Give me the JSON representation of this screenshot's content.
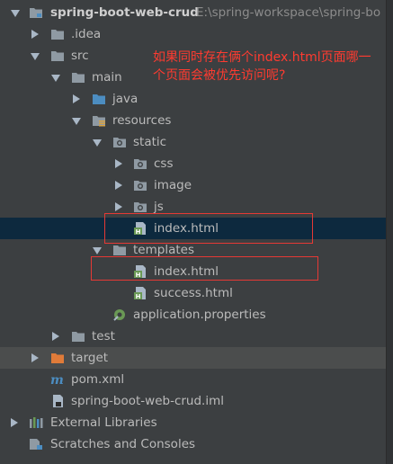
{
  "project": {
    "name": "spring-boot-web-crud",
    "path": "E:\\spring-workspace\\spring-bo"
  },
  "tree": {
    "idea": ".idea",
    "src": "src",
    "main": "main",
    "java": "java",
    "resources": "resources",
    "static": "static",
    "css": "css",
    "image": "image",
    "js": "js",
    "static_index": "index.html",
    "templates": "templates",
    "templates_index": "index.html",
    "success": "success.html",
    "app_props": "application.properties",
    "test": "test",
    "target": "target",
    "pom": "pom.xml",
    "iml": "spring-boot-web-crud.iml",
    "external_libraries": "External Libraries",
    "scratches": "Scratches and Consoles"
  },
  "annotation": "如果同时存在俩个index.html页面哪一个页面会被优先访问呢?",
  "colors": {
    "background": "#3c3f41",
    "selected_row": "#0d293e",
    "hover_row": "#4b4d4d",
    "annotation_red": "#ff3b30",
    "folder_gray": "#8f9aa3",
    "folder_blue": "#4c8dc1",
    "folder_orange": "#e07b39",
    "html_green": "#6a9955"
  }
}
